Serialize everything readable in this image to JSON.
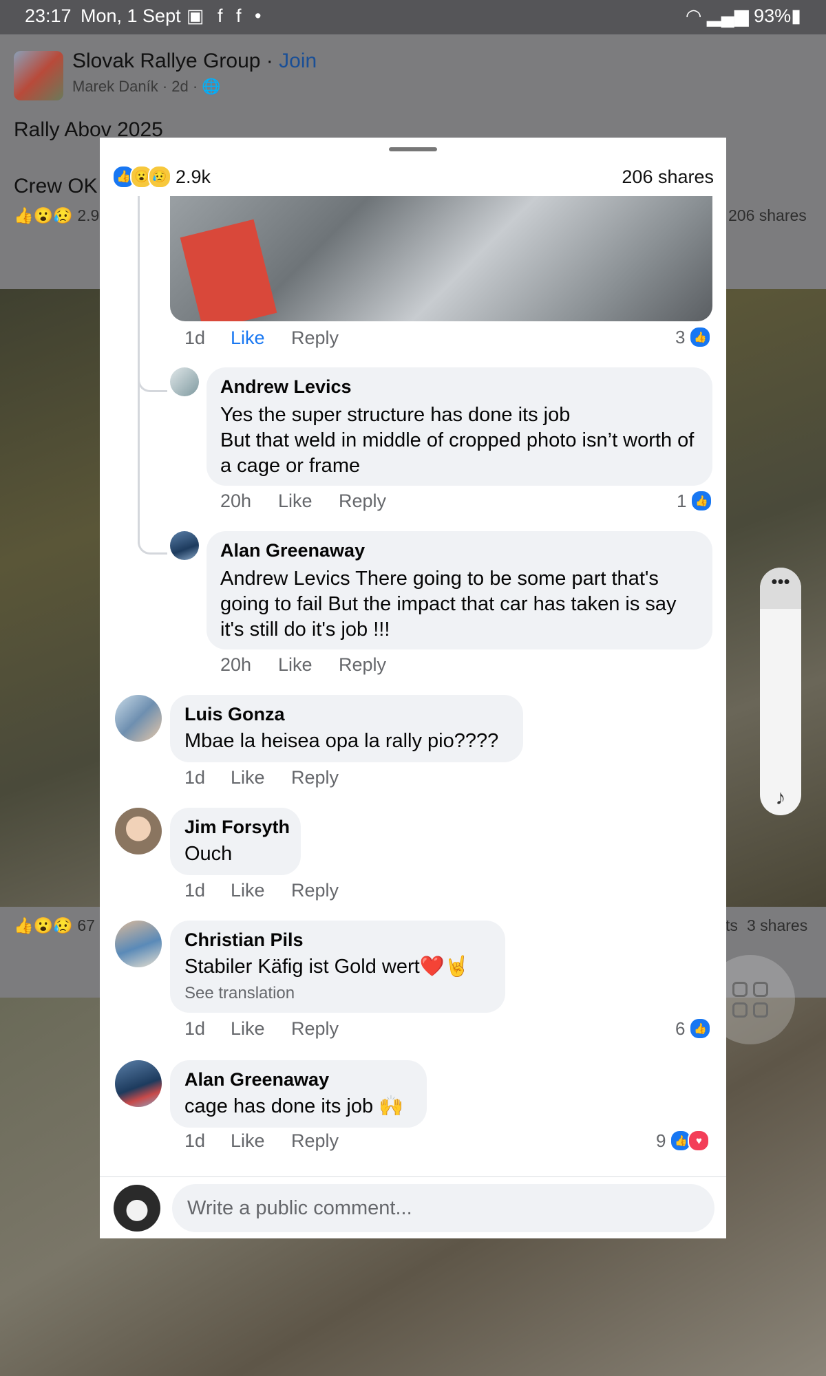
{
  "status_bar": {
    "time": "23:17",
    "date": "Mon, 1 Sept",
    "notification_icons": "▣ f f •",
    "battery": "93%"
  },
  "background_post": {
    "group_name": "Slovak Rallye Group",
    "separator": " · ",
    "join_label": "Join",
    "author_meta": "Marek Daník · 2d · ",
    "text_line_1": "Rally Abov 2025",
    "text_line_2": "Crew OK",
    "reaction_count": "2.9",
    "shares": "206 shares",
    "second_reaction_count": "67",
    "second_shares": "3 shares",
    "second_partial": "ts"
  },
  "modal": {
    "reaction_total": "2.9k",
    "shares": "206 shares",
    "top_comment_actions": {
      "time": "1d",
      "like": "Like",
      "reply": "Reply",
      "reaction_count": "3"
    },
    "comments": [
      {
        "author": "Andrew Levics",
        "text": "Yes the super structure has done its job\nBut that weld in middle of cropped photo isn’t worth of a cage or frame",
        "time": "20h",
        "like": "Like",
        "reply": "Reply",
        "reaction_count": "1"
      },
      {
        "author": "Alan Greenaway",
        "text": "Andrew Levics There going to be some part that's going to fail But the impact that car has taken is say it's still do it's job !!!",
        "time": "20h",
        "like": "Like",
        "reply": "Reply"
      },
      {
        "author": "Luis Gonza",
        "text": "Mbae la heisea opa la rally pio????",
        "time": "1d",
        "like": "Like",
        "reply": "Reply"
      },
      {
        "author": "Jim Forsyth",
        "text": "Ouch",
        "time": "1d",
        "like": "Like",
        "reply": "Reply"
      },
      {
        "author": "Christian Pils",
        "text": "Stabiler Käfig ist Gold wert❤️🤘",
        "see_translation": "See translation",
        "time": "1d",
        "like": "Like",
        "reply": "Reply",
        "reaction_count": "6"
      },
      {
        "author": "Alan Greenaway",
        "text": "cage has done its job 🙌",
        "time": "1d",
        "like": "Like",
        "reply": "Reply",
        "reaction_count": "9"
      }
    ],
    "composer_placeholder": "Write a public comment..."
  },
  "colors": {
    "accent": "#1877f2",
    "bubble": "#f0f2f5",
    "secondary_text": "#65676b"
  },
  "icons": [
    "like-reaction-icon",
    "wow-reaction-icon",
    "sad-reaction-icon",
    "love-reaction-icon",
    "globe-icon",
    "more-dots-icon",
    "music-icon",
    "apps-grid-icon"
  ]
}
